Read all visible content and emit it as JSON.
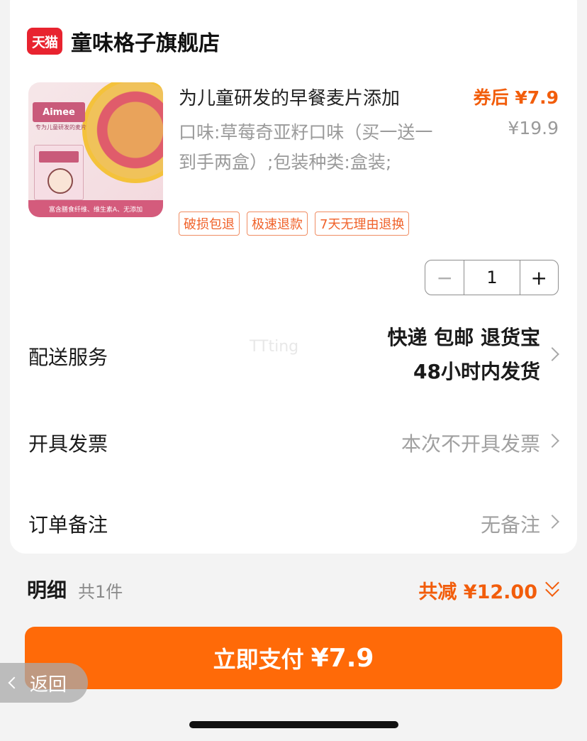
{
  "shop": {
    "logo_text": "天猫",
    "name": "童味格子旗舰店"
  },
  "product": {
    "image_texts": {
      "brand": "Aimee",
      "subtitle": "专为儿童研发的麦片",
      "bottom": "富含膳食纤维、维生素A、无添加"
    },
    "title": "为儿童研发的早餐麦片添加",
    "price_after_coupon": "券后 ¥7.9",
    "spec": "口味:草莓奇亚籽口味（买一送一到手两盒）;包装种类:盒装;",
    "original_price": "¥19.9",
    "tags": [
      "破损包退",
      "极速退款",
      "7天无理由退换"
    ],
    "quantity": "1",
    "minus_label": "−",
    "plus_label": "+"
  },
  "delivery": {
    "label": "配送服务",
    "line1": "快递 包邮 退货宝",
    "line2": "48小时内发货"
  },
  "invoice": {
    "label": "开具发票",
    "value": "本次不开具发票"
  },
  "remark": {
    "label": "订单备注",
    "value": "无备注"
  },
  "watermark": "TTting",
  "summary": {
    "detail_label": "明细",
    "count": "共1件",
    "discount": "共减 ¥12.00"
  },
  "pay_button": {
    "label": "立即支付",
    "amount": "¥7.9"
  },
  "back": {
    "label": "返回"
  },
  "colors": {
    "accent": "#ff6a08",
    "price": "#f25d0b",
    "tmall_red": "#e8232f"
  }
}
